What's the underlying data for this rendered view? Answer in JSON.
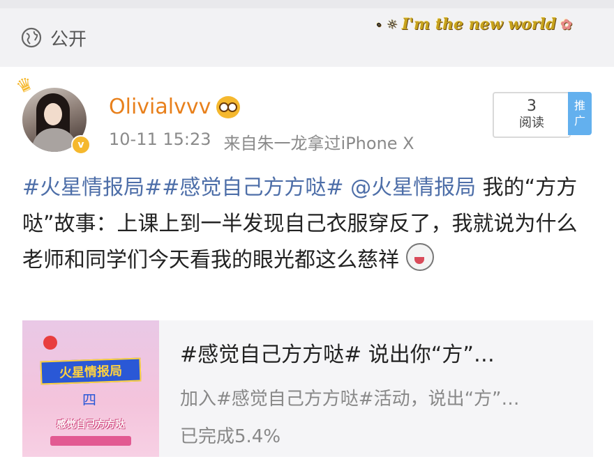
{
  "visibility": {
    "icon": "globe-icon",
    "label": "公开"
  },
  "sticker": {
    "text": "I'm the new world"
  },
  "post": {
    "username": "Olivialvvv",
    "timestamp": "10-11 15:23",
    "source": "来自朱一龙拿过iPhone X",
    "reads": {
      "count": "3",
      "label": "阅读"
    },
    "promote_label": "推广",
    "text": {
      "tag1": "#火星情报局#",
      "tag2": "#感觉自己方方哒#",
      "mention": "@火星情报局",
      "body": "我的“方方哒”故事：上课上到一半发现自己衣服穿反了，我就说为什么老师和同学们今天看我的眼光都这么慈祥"
    }
  },
  "topic": {
    "thumb_banner": "火星情报局",
    "thumb_number": "四",
    "thumb_caption": "感觉自己方方哒",
    "title": "#感觉自己方方哒# 说出你“方”…",
    "description": "加入#感觉自己方方哒#活动，说出“方”…",
    "progress": "已完成5.4%"
  },
  "colors": {
    "username": "#e8801c",
    "link": "#4d6ea8",
    "promote": "#63b0ee"
  }
}
